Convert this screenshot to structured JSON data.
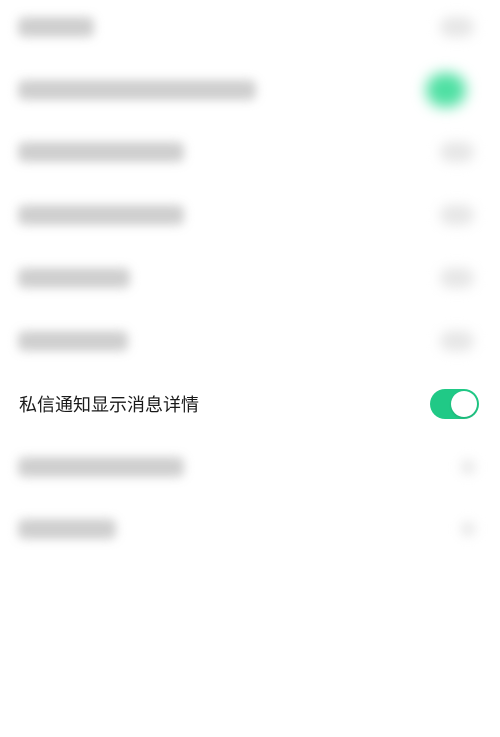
{
  "settings": {
    "visible_item": {
      "label": "私信通知显示消息详情",
      "enabled": true,
      "accent_color": "#20c986"
    },
    "obscured_items_count": 8
  }
}
